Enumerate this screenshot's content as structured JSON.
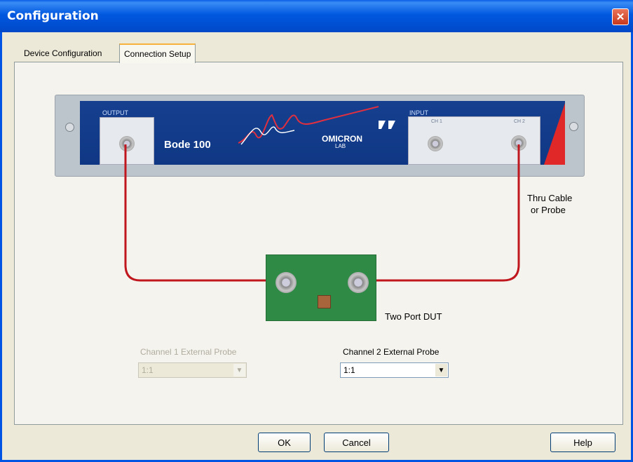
{
  "window": {
    "title": "Configuration",
    "close_glyph": "✕"
  },
  "tabs": [
    {
      "label": "Device Configuration",
      "active": false
    },
    {
      "label": "Connection Setup",
      "active": true
    }
  ],
  "device": {
    "output_label": "OUTPUT",
    "input_label": "INPUT",
    "ch1_label": "CH 1",
    "ch2_label": "CH 2",
    "model": "Bode 100",
    "brand_top": "OMICRON",
    "brand_bottom": "LAB"
  },
  "diagram": {
    "cable_label_line1": "Thru Cable",
    "cable_label_line2": "or Probe",
    "dut_label": "Two Port DUT",
    "cable_color": "#c0161e"
  },
  "probes": {
    "ch1_label": "Channel 1 External Probe",
    "ch1_value": "1:1",
    "ch1_enabled": false,
    "ch2_label": "Channel 2 External Probe",
    "ch2_value": "1:1",
    "ch2_enabled": true
  },
  "buttons": {
    "ok": "OK",
    "cancel": "Cancel",
    "help": "Help"
  },
  "colors": {
    "titlebar": "#0054e3",
    "panel": "#16408f",
    "accent_red": "#e02828",
    "board_green": "#2f8a46"
  }
}
